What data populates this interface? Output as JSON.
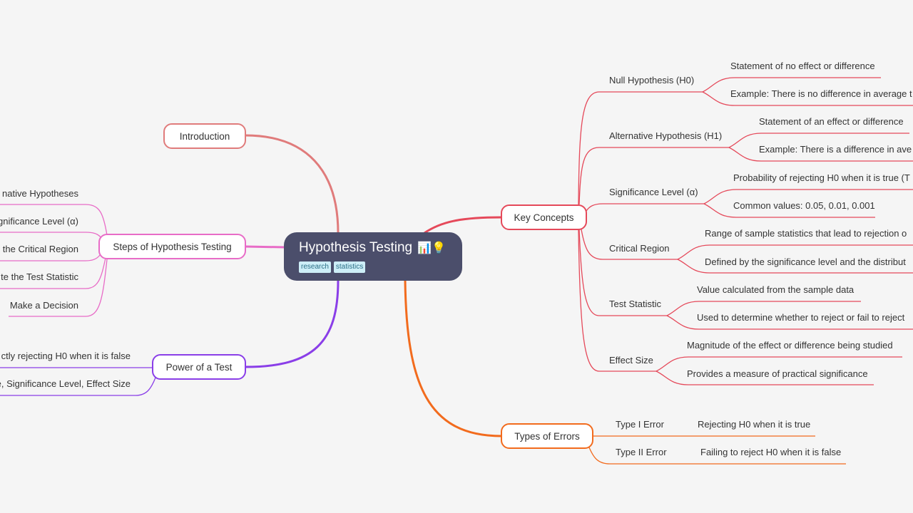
{
  "root": {
    "title": "Hypothesis Testing",
    "emoji": "📊💡",
    "tags": [
      "research",
      "statistics"
    ]
  },
  "colors": {
    "background": "#f5f5f5",
    "root_fill": "#4b4e6b",
    "introduction": "#e07b7b",
    "steps": "#e86cc7",
    "power": "#8a3ee8",
    "key_concepts": "#e5495a",
    "types_of_errors": "#f26b1d",
    "tag_bg": "#cdeef7",
    "tag_text": "#2a6f86"
  },
  "left": {
    "introduction": {
      "label": "Introduction",
      "children": []
    },
    "steps": {
      "label": "Steps of Hypothesis Testing",
      "children": [
        "native Hypotheses",
        "gnificance Level (α)",
        "the Critical Region",
        "te the Test Statistic",
        "Make a Decision"
      ]
    },
    "power": {
      "label": "Power of a Test",
      "children": [
        "ctly rejecting H0 when it is false",
        "e, Significance Level, Effect Size"
      ]
    }
  },
  "right": {
    "key_concepts": {
      "label": "Key Concepts",
      "children": [
        {
          "label": "Null Hypothesis (H0)",
          "children": [
            "Statement of no effect or difference",
            "Example: There is no difference in average t"
          ]
        },
        {
          "label": "Alternative Hypothesis (H1)",
          "children": [
            "Statement of an effect or difference",
            "Example: There is a difference in ave"
          ]
        },
        {
          "label": "Significance Level (α)",
          "children": [
            "Probability of rejecting H0 when it is true (T",
            "Common values: 0.05, 0.01, 0.001"
          ]
        },
        {
          "label": "Critical Region",
          "children": [
            "Range of sample statistics that lead to rejection o",
            "Defined by the significance level and the distribut"
          ]
        },
        {
          "label": "Test Statistic",
          "children": [
            "Value calculated from the sample data",
            "Used to determine whether to reject or fail to reject"
          ]
        },
        {
          "label": "Effect Size",
          "children": [
            "Magnitude of the effect or difference being studied",
            "Provides a measure of practical significance"
          ]
        }
      ]
    },
    "types_of_errors": {
      "label": "Types of Errors",
      "children": [
        {
          "label": "Type I Error",
          "children": [
            "Rejecting H0 when it is true"
          ]
        },
        {
          "label": "Type II Error",
          "children": [
            "Failing to reject H0 when it is false"
          ]
        }
      ]
    }
  }
}
